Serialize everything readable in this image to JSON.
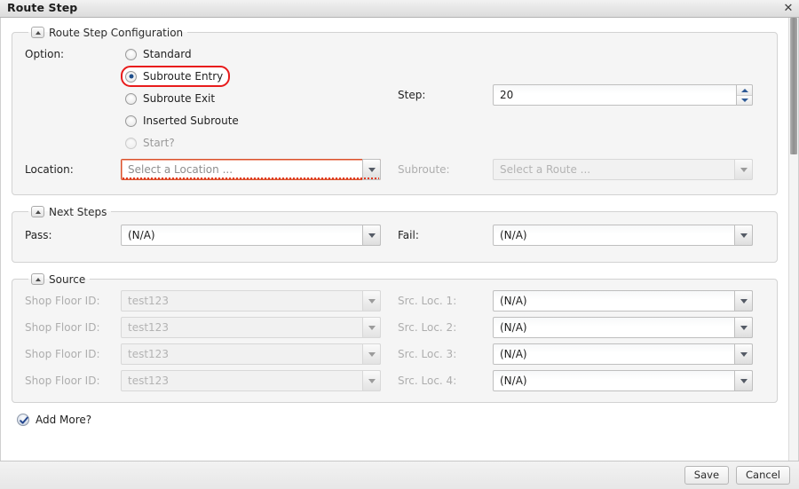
{
  "window": {
    "title": "Route Step",
    "close_icon": "close-icon"
  },
  "sections": {
    "config": {
      "legend": "Route Step Configuration",
      "collapse_icon": "triangle-up-icon",
      "option_label": "Option:",
      "options": [
        {
          "label": "Standard",
          "checked": false,
          "disabled": false,
          "highlighted": false
        },
        {
          "label": "Subroute Entry",
          "checked": true,
          "disabled": false,
          "highlighted": true
        },
        {
          "label": "Subroute Exit",
          "checked": false,
          "disabled": false,
          "highlighted": false
        },
        {
          "label": "Inserted Subroute",
          "checked": false,
          "disabled": false,
          "highlighted": false
        },
        {
          "label": "Start?",
          "checked": false,
          "disabled": true,
          "highlighted": false
        }
      ],
      "step_label": "Step:",
      "step_value": "20",
      "location_label": "Location:",
      "location_value": "Select a Location ...",
      "subroute_label": "Subroute:",
      "subroute_value": "Select a Route ..."
    },
    "next_steps": {
      "legend": "Next Steps",
      "collapse_icon": "triangle-up-icon",
      "pass_label": "Pass:",
      "pass_value": "(N/A)",
      "fail_label": "Fail:",
      "fail_value": "(N/A)"
    },
    "source": {
      "legend": "Source",
      "collapse_icon": "triangle-up-icon",
      "rows": [
        {
          "shop_floor_label": "Shop Floor ID:",
          "shop_floor_value": "test123",
          "src_loc_label": "Src. Loc. 1:",
          "src_loc_value": "(N/A)"
        },
        {
          "shop_floor_label": "Shop Floor ID:",
          "shop_floor_value": "test123",
          "src_loc_label": "Src. Loc. 2:",
          "src_loc_value": "(N/A)"
        },
        {
          "shop_floor_label": "Shop Floor ID:",
          "shop_floor_value": "test123",
          "src_loc_label": "Src. Loc. 3:",
          "src_loc_value": "(N/A)"
        },
        {
          "shop_floor_label": "Shop Floor ID:",
          "shop_floor_value": "test123",
          "src_loc_label": "Src. Loc. 4:",
          "src_loc_value": "(N/A)"
        }
      ]
    }
  },
  "add_more": {
    "label": "Add More?",
    "checked": true,
    "icon": "checkmark-circle-icon"
  },
  "footer": {
    "save_label": "Save",
    "cancel_label": "Cancel"
  },
  "colors": {
    "validation_red": "#d9512c",
    "highlight_red": "#e81c1c",
    "radio_selected": "#1f4f8c",
    "spinner_blue": "#2e5a96"
  }
}
